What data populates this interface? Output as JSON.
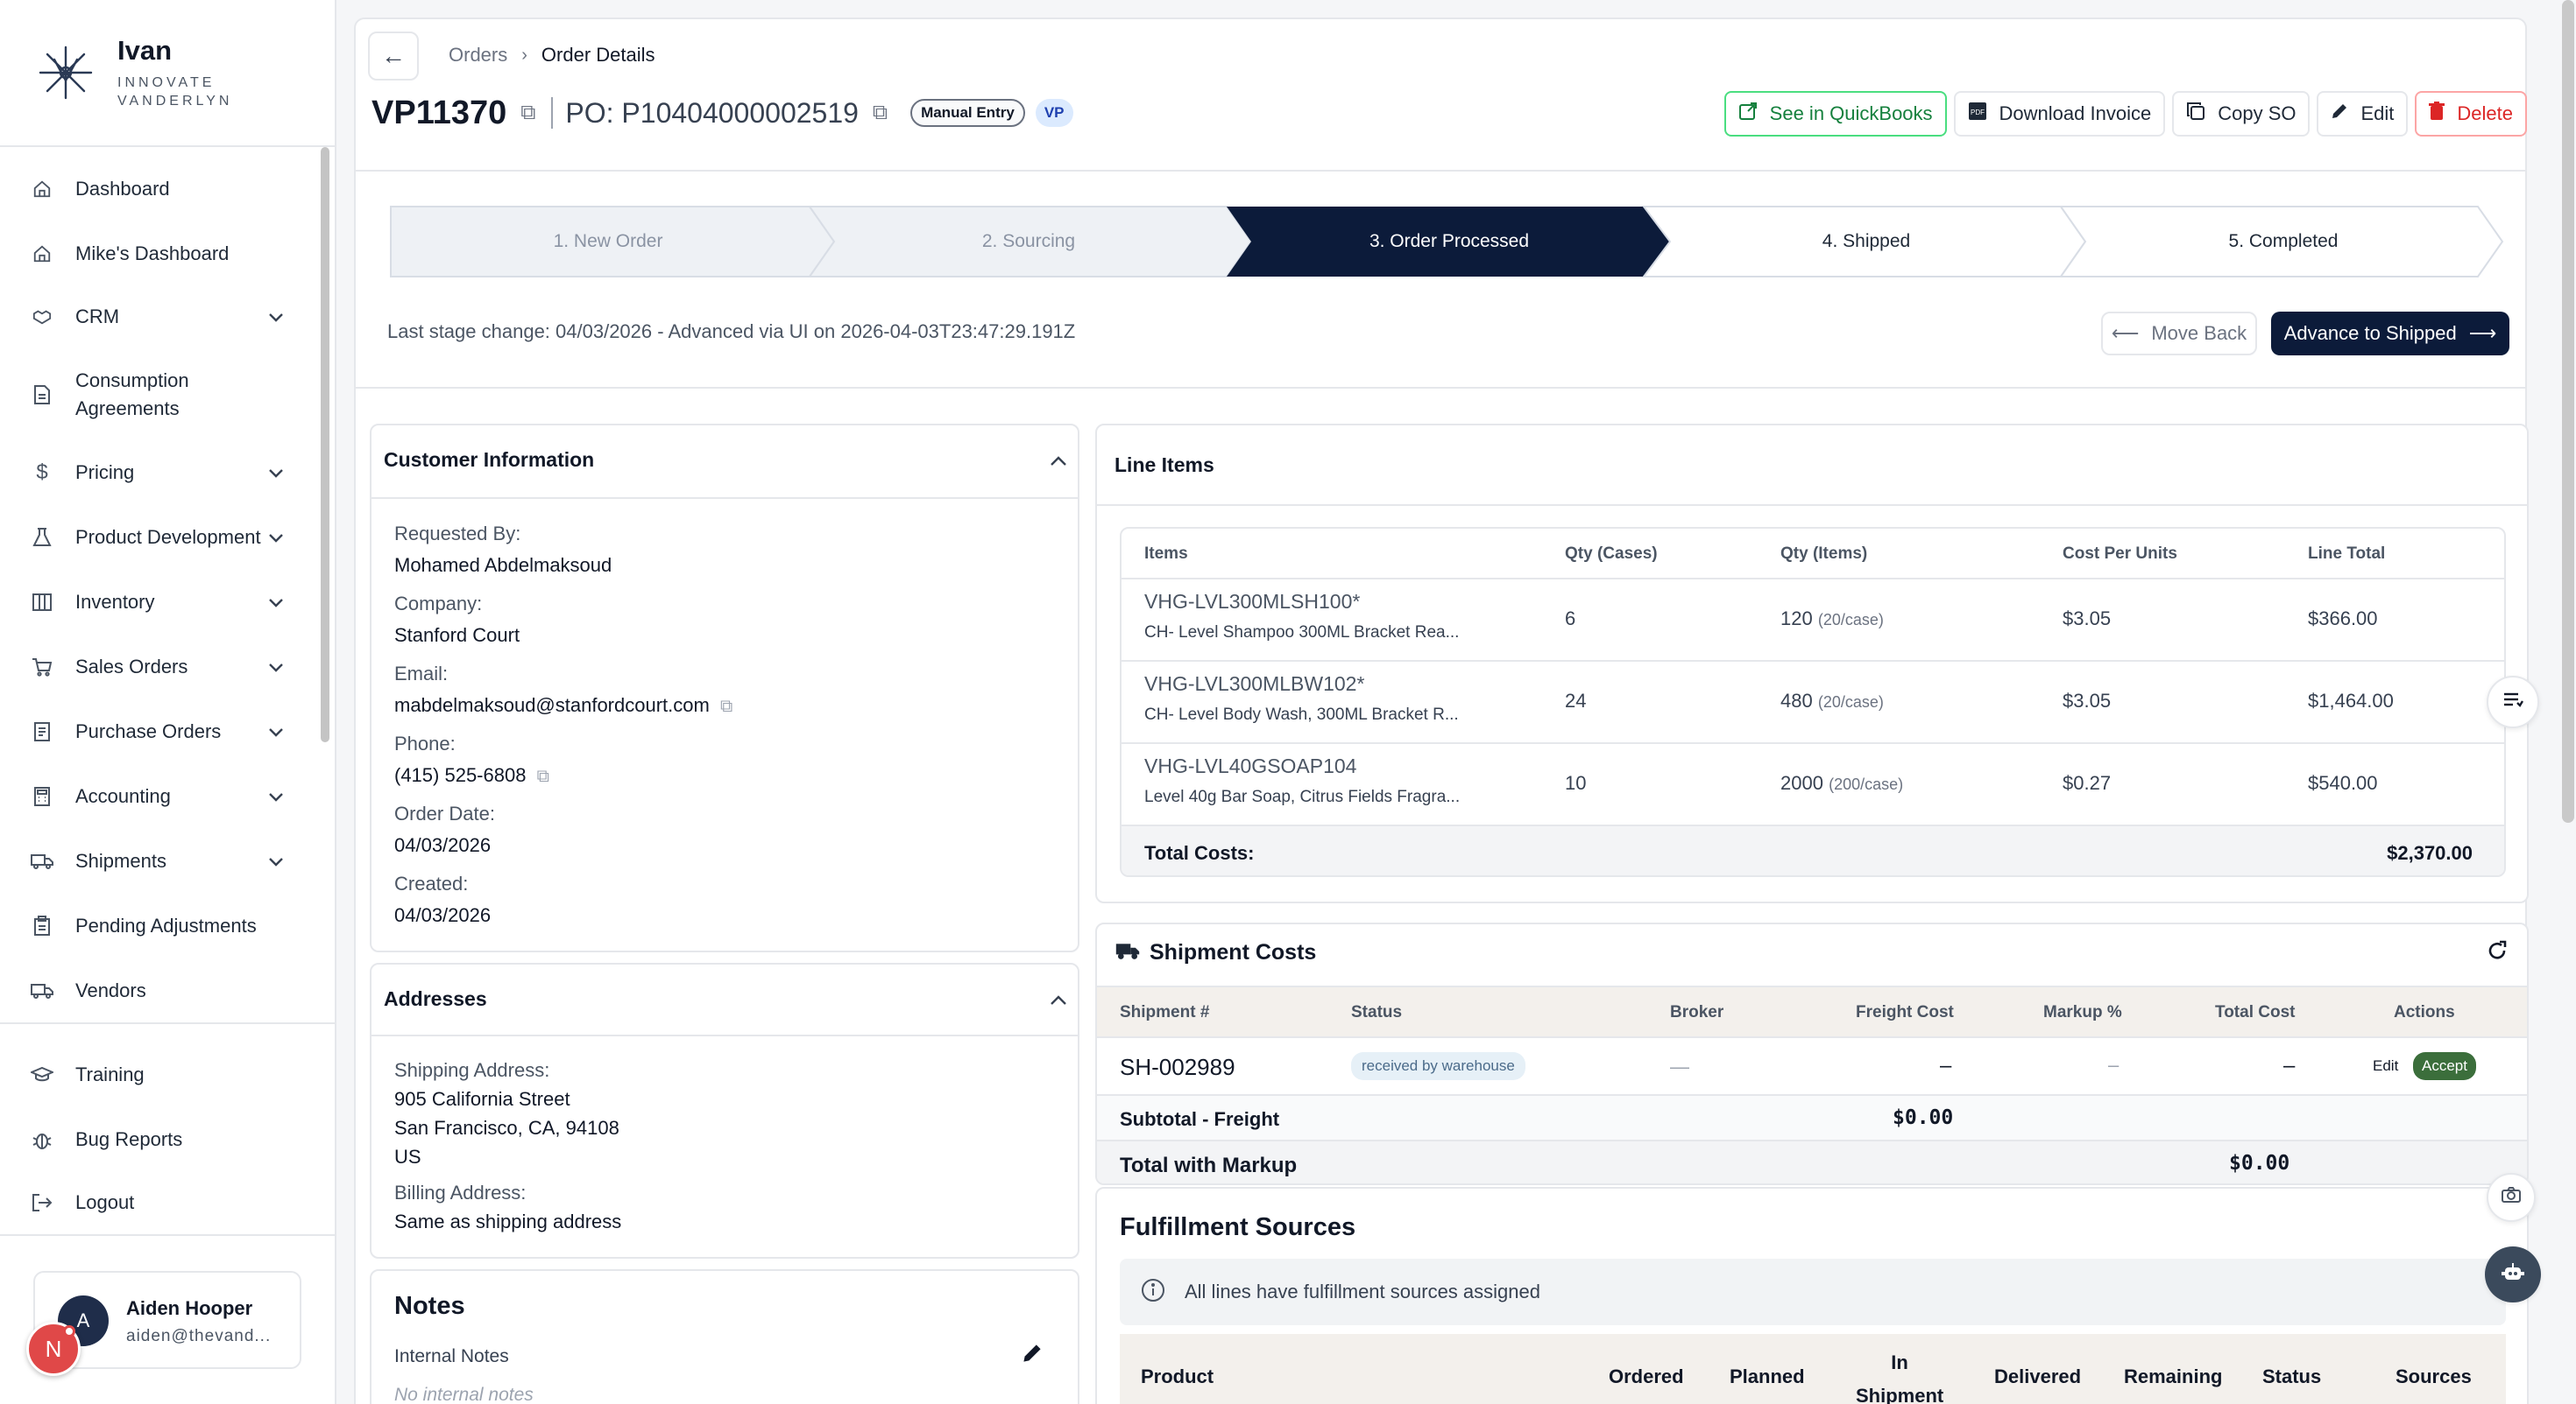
{
  "brand": {
    "name": "Ivan",
    "subtitle_line1": "INNOVATE",
    "subtitle_line2": "VANDERLYN"
  },
  "sidebar": {
    "items": [
      {
        "label": "Dashboard",
        "icon": "home-icon"
      },
      {
        "label": "Mike's Dashboard",
        "icon": "home-icon"
      },
      {
        "label": "CRM",
        "icon": "handshake-icon"
      },
      {
        "label": "Consumption",
        "label2": "Agreements",
        "icon": "document-icon"
      },
      {
        "label": "Pricing",
        "icon": "dollar-icon"
      },
      {
        "label": "Product Development",
        "icon": "flask-icon"
      },
      {
        "label": "Inventory",
        "icon": "warehouse-icon"
      },
      {
        "label": "Sales Orders",
        "icon": "cart-icon"
      },
      {
        "label": "Purchase Orders",
        "icon": "receipt-icon"
      },
      {
        "label": "Accounting",
        "icon": "calculator-icon"
      },
      {
        "label": "Shipments",
        "icon": "truck-icon"
      },
      {
        "label": "Pending Adjustments",
        "icon": "clipboard-icon"
      },
      {
        "label": "Vendors",
        "icon": "truck-icon"
      },
      {
        "label": "Training",
        "icon": "graduation-cap-icon"
      },
      {
        "label": "Bug Reports",
        "icon": "bug-icon"
      },
      {
        "label": "Logout",
        "icon": "logout-icon"
      }
    ],
    "user": {
      "initial": "A",
      "name": "Aiden Hooper",
      "email": "aiden@thevand..."
    },
    "notification_initial": "N"
  },
  "breadcrumb": {
    "parent": "Orders",
    "current": "Order Details"
  },
  "order": {
    "id": "VP11370",
    "po": "PO: P10404000002519",
    "badge_entry": "Manual Entry",
    "badge_vp": "VP"
  },
  "actions": {
    "quickbooks": "See in QuickBooks",
    "download": "Download Invoice",
    "copy_so": "Copy SO",
    "edit": "Edit",
    "delete": "Delete"
  },
  "stages": [
    {
      "label": "1. New Order",
      "state": "done"
    },
    {
      "label": "2. Sourcing",
      "state": "done"
    },
    {
      "label": "3. Order Processed",
      "state": "current"
    },
    {
      "label": "4. Shipped",
      "state": "todo"
    },
    {
      "label": "5. Completed",
      "state": "todo"
    }
  ],
  "stage_info": {
    "last_change": "Last stage change: 04/03/2026 - Advanced via UI on 2026-04-03T23:47:29.191Z",
    "move_back": "Move Back",
    "advance": "Advance to Shipped"
  },
  "customer": {
    "title": "Customer Information",
    "requested_by_label": "Requested By:",
    "requested_by": "Mohamed Abdelmaksoud",
    "company_label": "Company:",
    "company": "Stanford Court",
    "email_label": "Email:",
    "email": "mabdelmaksoud@stanfordcourt.com",
    "phone_label": "Phone:",
    "phone": "(415) 525-6808",
    "order_date_label": "Order Date:",
    "order_date": "04/03/2026",
    "created_label": "Created:",
    "created": "04/03/2026"
  },
  "addresses": {
    "title": "Addresses",
    "shipping_label": "Shipping Address:",
    "shipping_line1": "905 California Street",
    "shipping_line2": "San Francisco, CA, 94108",
    "shipping_line3": "US",
    "billing_label": "Billing Address:",
    "billing": "Same as shipping address"
  },
  "notes": {
    "title": "Notes",
    "internal_label": "Internal Notes",
    "internal_placeholder": "No internal notes"
  },
  "line_items": {
    "title": "Line Items",
    "headers": [
      "Items",
      "Qty (Cases)",
      "Qty (Items)",
      "Cost Per Units",
      "Line Total"
    ],
    "rows": [
      {
        "sku": "VHG-LVL300MLSH100*",
        "desc": "CH- Level Shampoo 300ML Bracket Rea...",
        "cases": "6",
        "items": "120",
        "per_case": "(20/case)",
        "unit_cost": "$3.05",
        "total": "$366.00"
      },
      {
        "sku": "VHG-LVL300MLBW102*",
        "desc": "CH- Level Body Wash, 300ML Bracket R...",
        "cases": "24",
        "items": "480",
        "per_case": "(20/case)",
        "unit_cost": "$3.05",
        "total": "$1,464.00"
      },
      {
        "sku": "VHG-LVL40GSOAP104",
        "desc": "Level 40g Bar Soap, Citrus Fields Fragra...",
        "cases": "10",
        "items": "2000",
        "per_case": "(200/case)",
        "unit_cost": "$0.27",
        "total": "$540.00"
      }
    ],
    "total_label": "Total Costs:",
    "total_value": "$2,370.00"
  },
  "shipment_costs": {
    "title": "Shipment Costs",
    "headers": [
      "Shipment #",
      "Status",
      "Broker",
      "Freight Cost",
      "Markup %",
      "Total Cost",
      "Actions"
    ],
    "row": {
      "id": "SH-002989",
      "status": "received by warehouse",
      "broker": "—",
      "freight": "–",
      "markup": "–",
      "total": "–",
      "edit": "Edit",
      "accept": "Accept"
    },
    "subtotal_label": "Subtotal - Freight",
    "subtotal_value": "$0.00",
    "markup_label": "Total with Markup",
    "markup_value": "$0.00"
  },
  "fulfillment": {
    "title": "Fulfillment Sources",
    "info": "All lines have fulfillment sources assigned",
    "headers": {
      "product": "Product",
      "ordered": "Ordered",
      "planned": "Planned",
      "in_shipment_1": "In",
      "in_shipment_2": "Shipment",
      "delivered": "Delivered",
      "remaining": "Remaining",
      "status": "Status",
      "sources": "Sources"
    }
  },
  "colors": {
    "navy": "#0c1b3a",
    "qb_green": "#15803d",
    "delete_red": "#dc2626",
    "accept_green": "#3b6e3b"
  }
}
